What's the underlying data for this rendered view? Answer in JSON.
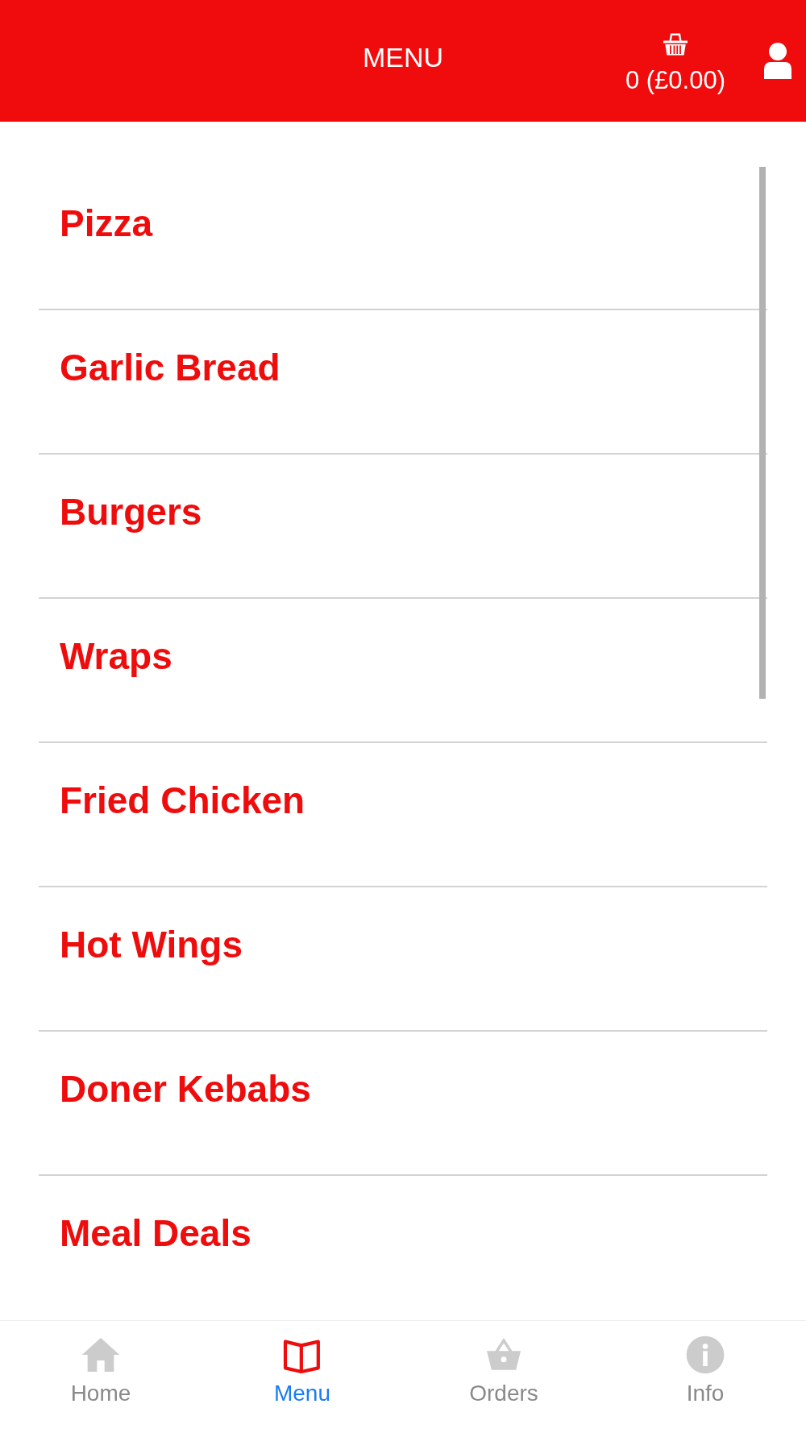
{
  "header": {
    "title": "MENU",
    "cart_summary": "0 (£0.00)"
  },
  "categories": [
    {
      "label": "Pizza"
    },
    {
      "label": "Garlic Bread"
    },
    {
      "label": "Burgers"
    },
    {
      "label": "Wraps"
    },
    {
      "label": "Fried Chicken"
    },
    {
      "label": "Hot Wings"
    },
    {
      "label": "Doner Kebabs"
    },
    {
      "label": "Meal Deals"
    }
  ],
  "bottom_nav": [
    {
      "kind": "home",
      "label": "Home",
      "selected": false
    },
    {
      "kind": "menu",
      "label": "Menu",
      "selected": true
    },
    {
      "kind": "orders",
      "label": "Orders",
      "selected": false
    },
    {
      "kind": "info",
      "label": "Info",
      "selected": false
    }
  ]
}
